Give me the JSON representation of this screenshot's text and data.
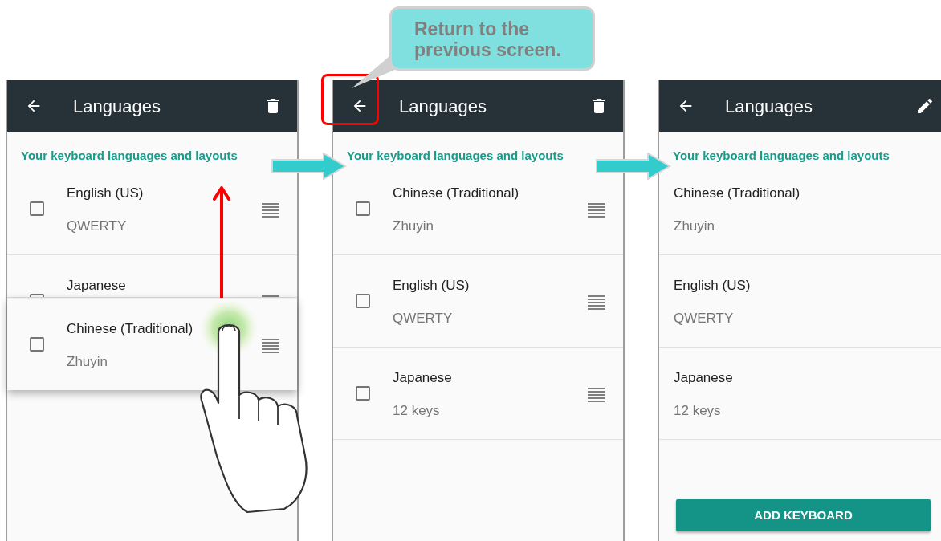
{
  "screens": [
    {
      "kind": "reorder",
      "title": "Languages",
      "subtitle": "Your keyboard languages and layouts",
      "items": [
        {
          "kind": "row",
          "name": "English (US)",
          "layout": "QWERTY",
          "checked": false
        },
        {
          "kind": "covered",
          "name": "Japanese",
          "checked": false
        },
        {
          "kind": "dragged",
          "name": "Chinese (Traditional)",
          "layout": "Zhuyin",
          "checked": false
        }
      ]
    },
    {
      "kind": "reorder",
      "title": "Languages",
      "subtitle": "Your keyboard languages and layouts",
      "items": [
        {
          "kind": "row",
          "name": "Chinese (Traditional)",
          "layout": "Zhuyin",
          "checked": false
        },
        {
          "kind": "row",
          "name": "English (US)",
          "layout": "QWERTY",
          "checked": false
        },
        {
          "kind": "row",
          "name": "Japanese",
          "layout": "12 keys",
          "checked": false
        }
      ]
    },
    {
      "kind": "overview",
      "title": "Languages",
      "subtitle": "Your keyboard languages and layouts",
      "items": [
        {
          "kind": "row",
          "name": "Chinese (Traditional)",
          "layout": "Zhuyin"
        },
        {
          "kind": "row",
          "name": "English (US)",
          "layout": "QWERTY"
        },
        {
          "kind": "row",
          "name": "Japanese",
          "layout": "12 keys"
        }
      ],
      "button": "ADD KEYBOARD"
    }
  ],
  "callout": {
    "text": "Return to the previous screen."
  }
}
